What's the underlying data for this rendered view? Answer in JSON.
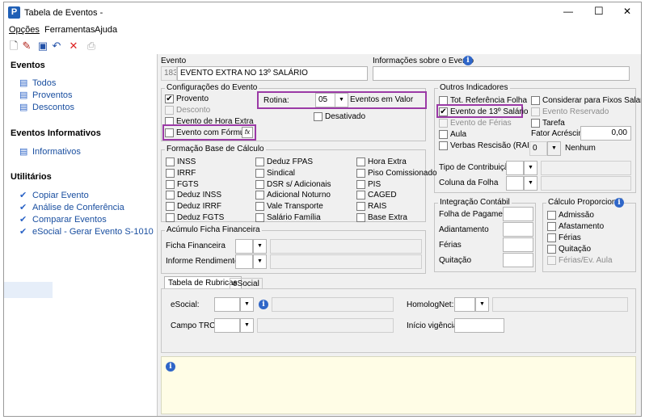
{
  "window": {
    "title": "Tabela de Eventos -",
    "app_icon": "P",
    "minimize": "—",
    "maximize": "☐",
    "close": "✕"
  },
  "menu": [
    "Opções",
    "Ferramentas",
    "Ajuda"
  ],
  "sidebar": {
    "eventos": {
      "heading": "Eventos",
      "items": [
        "Todos",
        "Proventos",
        "Descontos"
      ]
    },
    "informativos": {
      "heading": "Eventos Informativos",
      "items": [
        "Informativos"
      ]
    },
    "utilitarios": {
      "heading": "Utilitários",
      "items": [
        "Copiar Evento",
        "Análise de Conferência",
        "Comparar Eventos",
        "eSocial - Gerar Evento S-1010"
      ]
    }
  },
  "evento": {
    "label": "Evento",
    "code": "183",
    "name": "EVENTO EXTRA NO 13º SALÁRIO",
    "info_label": "Informações sobre o Evento",
    "info_value": ""
  },
  "config": {
    "title": "Configurações do Evento",
    "proventos": "Provento",
    "desconto": "Desconto",
    "hora_extra": "Evento de Hora Extra",
    "formula": "Evento com Fórmula",
    "formula_btn": "fx",
    "rotina_label": "Rotina:",
    "rotina_value": "05",
    "rotina_desc": "Eventos em Valor",
    "desativado": "Desativado"
  },
  "base": {
    "title": "Formação Base de Cálculo",
    "col1": [
      "INSS",
      "IRRF",
      "FGTS",
      "Deduz INSS",
      "Deduz IRRF",
      "Deduz FGTS"
    ],
    "col2": [
      "Deduz FPAS",
      "Sindical",
      "DSR s/ Adicionais",
      "Adicional Noturno",
      "Vale Transporte",
      "Salário Família"
    ],
    "col3": [
      "Hora Extra",
      "Piso Comissionado",
      "PIS",
      "CAGED",
      "RAIS",
      "Base Extra"
    ]
  },
  "acumulo": {
    "title": "Acúmulo Ficha Financeira",
    "ficha": "Ficha Financeira",
    "informe": "Informe Rendimentos"
  },
  "outros": {
    "title": "Outros Indicadores",
    "tot_ref": "Tot. Referência Folha",
    "decimo": "Evento de 13º Salário",
    "ferias": "Evento de Férias",
    "aula": "Aula",
    "verbas": "Verbas Rescisão (RAIS)",
    "fixos": "Considerar para Fixos Salariais",
    "reservado": "Evento Reservado",
    "tarefa": "Tarefa",
    "fator_label": "Fator Acréscimo",
    "fator_value": "0,00",
    "nenhum_code": "0",
    "nenhum": "Nenhum",
    "tipo_contrib": "Tipo de Contribuição",
    "coluna_folha": "Coluna da Folha"
  },
  "integracao": {
    "title": "Integração Contábil",
    "rows": [
      "Folha de Pagamento",
      "Adiantamento",
      "Férias",
      "Quitação"
    ]
  },
  "proporcional": {
    "title": "Cálculo Proporcional",
    "rows": [
      "Admissão",
      "Afastamento",
      "Férias",
      "Quitação",
      "Férias/Ev. Aula"
    ]
  },
  "tabs": {
    "rubricas": "Tabela de Rubricas",
    "esocial": "eSocial"
  },
  "rubricas": {
    "esocial": "eSocial:",
    "homolognet": "HomologNet:",
    "campo_trct": "Campo TRCT:",
    "inicio": "Início vigência:"
  },
  "info_panel": {
    "text": ""
  }
}
